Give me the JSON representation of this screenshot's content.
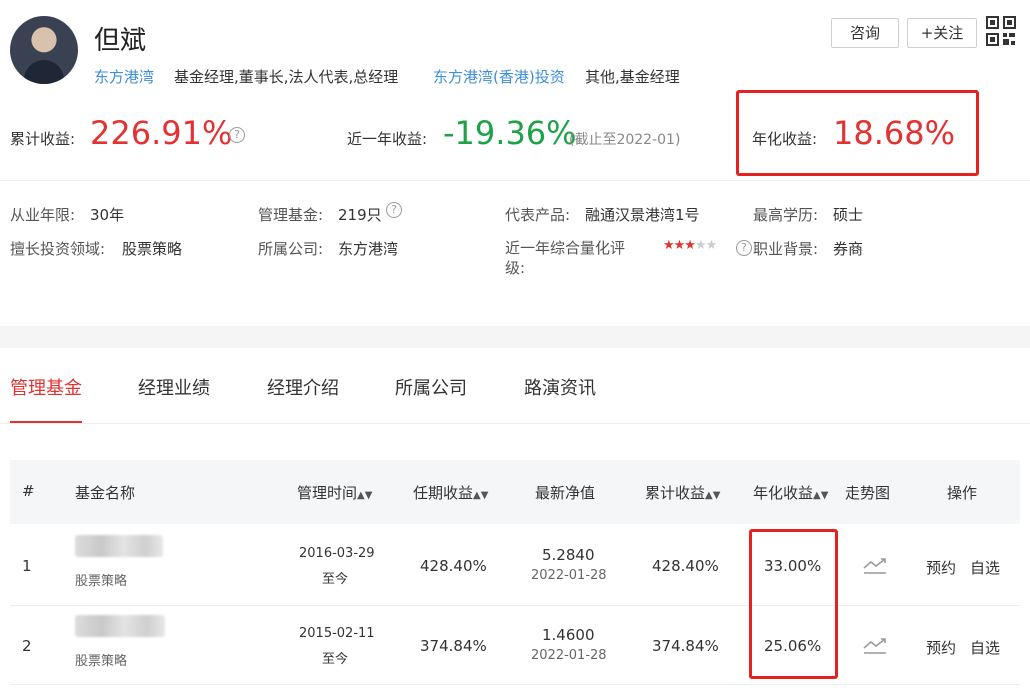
{
  "profile": {
    "name": "但斌",
    "company_link": "东方港湾",
    "company_roles": "基金经理,董事长,法人代表,总经理",
    "company2_link": "东方港湾(香港)投资",
    "company2_roles": "其他,基金经理",
    "consult_label": "咨询",
    "follow_label": "+关注"
  },
  "returns": {
    "cumulative_label": "累计收益:",
    "cumulative_value": "226.91%",
    "recent_label": "近一年收益:",
    "recent_value": "-19.36%",
    "recent_note": "(截止至2022-01)",
    "annual_label": "年化收益:",
    "annual_value": "18.68%"
  },
  "info": {
    "years_label": "从业年限:",
    "years_value": "30年",
    "funds_label": "管理基金:",
    "funds_value": "219只",
    "product_label": "代表产品:",
    "product_value": "融通汉景港湾1号",
    "edu_label": "最高学历:",
    "edu_value": "硕士",
    "field_label": "擅长投资领域:",
    "field_value": "股票策略",
    "company_label": "所属公司:",
    "company_value": "东方港湾",
    "rating_label": "近一年综合量化评级:",
    "rating_stars": 3,
    "rating_max": 5,
    "background_label": "职业背景:",
    "background_value": "券商"
  },
  "tabs": [
    {
      "label": "管理基金"
    },
    {
      "label": "经理业绩"
    },
    {
      "label": "经理介绍"
    },
    {
      "label": "所属公司"
    },
    {
      "label": "路演资讯"
    }
  ],
  "table": {
    "headers": {
      "index": "#",
      "name": "基金名称",
      "time": "管理时间",
      "tenure_return": "任期收益",
      "nav": "最新净值",
      "cumulative": "累计收益",
      "annual": "年化收益",
      "trend": "走势图",
      "action": "操作"
    },
    "rows": [
      {
        "index": "1",
        "type": "股票策略",
        "start": "2016-03-29",
        "end": "至今",
        "tenure_return": "428.40%",
        "nav": "5.2840",
        "nav_date": "2022-01-28",
        "cumulative": "428.40%",
        "annual": "33.00%",
        "reserve": "预约",
        "watch": "自选"
      },
      {
        "index": "2",
        "type": "股票策略",
        "start": "2015-02-11",
        "end": "至今",
        "tenure_return": "374.84%",
        "nav": "1.4600",
        "nav_date": "2022-01-28",
        "cumulative": "374.84%",
        "annual": "25.06%",
        "reserve": "预约",
        "watch": "自选"
      }
    ]
  },
  "colors": {
    "accent_red": "#e23232",
    "link_blue": "#3b8ed8",
    "positive_green": "#1fa14a",
    "highlight_red": "#e8201f"
  }
}
